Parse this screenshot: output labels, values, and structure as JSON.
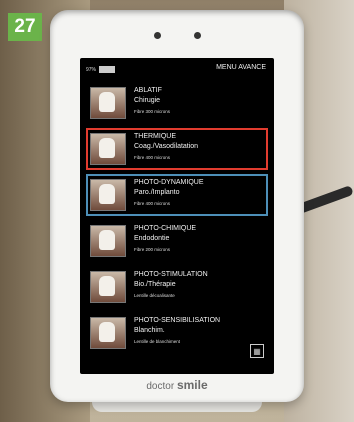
{
  "badge": "27",
  "screen": {
    "battery": "97%",
    "title": "MENU AVANCE",
    "items": [
      {
        "name": "ABLATIF",
        "sub": "Chirugie",
        "fiber": "Fibre 300 microns"
      },
      {
        "name": "THERMIQUE",
        "sub": "Coag./Vasodilatation",
        "fiber": "Fibre 400 microns"
      },
      {
        "name": "PHOTO-DYNAMIQUE",
        "sub": "Paro./Implanto",
        "fiber": "Fibre 400 microns"
      },
      {
        "name": "PHOTO-CHIMIQUE",
        "sub": "Endodontie",
        "fiber": "Fibre 200 microns"
      },
      {
        "name": "PHOTO-STIMULATION",
        "sub": "Bio./Thérapie",
        "fiber": "Lentille décoalisante"
      },
      {
        "name": "PHOTO-SENSIBILISATION",
        "sub": "Blanchim.",
        "fiber": "Lentille de blanchiment"
      }
    ]
  },
  "brand": {
    "prefix": "doctor",
    "name": "smile"
  },
  "colors": {
    "red_highlight": "#e23c2f",
    "blue_highlight": "#4d8fb8",
    "badge": "#6bb34a"
  }
}
